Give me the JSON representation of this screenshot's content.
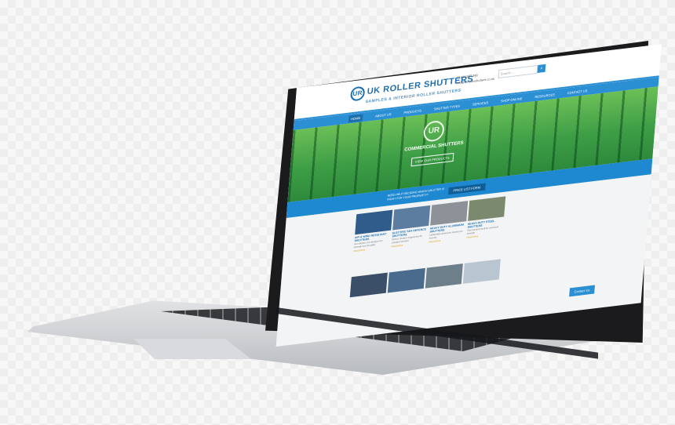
{
  "scene": {
    "description_label": "laptop-mockup",
    "colors": {
      "brand_blue": "#2b8fd4",
      "hero_green": "#3e9e46",
      "accent_gold": "#e2a51f"
    }
  },
  "website": {
    "logo": {
      "mark": "UR",
      "name": "UK ROLLER SHUTTERS",
      "tagline": "SAMPLES & INTERIOR ROLLER SHUTTERS"
    },
    "contact": {
      "phone": "01234 567 890",
      "email": "info@ukrollershutters.co.uk"
    },
    "search": {
      "placeholder": "Search ...",
      "button_icon": "search-icon"
    },
    "nav": [
      "HOME",
      "ABOUT US",
      "PRODUCTS",
      "SHUTTER TYPES",
      "SERVICES",
      "SHOP ONLINE",
      "RESOURCES",
      "CONTACT US"
    ],
    "hero": {
      "mark": "UR",
      "title": "COMMERCIAL SHUTTERS",
      "button": "VIEW OUR PRODUCTS"
    },
    "promo": {
      "text": "NEED HELP DECIDING WHICH SHUTTER IS RIGHT FOR YOUR PROPERTY?",
      "button": "PRICE LIST FORM"
    },
    "cards": [
      {
        "title": "AIR & WIND RESISTANT SHUTTERS",
        "text": "Our shutters are designed for strength and durability",
        "more": "Read More",
        "color": "#2f5c8a"
      },
      {
        "title": "ELECTRIC SEA DEFENCE SHUTTERS",
        "text": "Electric shutters engineered for coastal protection",
        "more": "Read More",
        "color": "#5d7da0"
      },
      {
        "title": "HEAVY DUTY ALUMINIUM SHUTTERS",
        "text": "Lightweight aluminium shutters for security",
        "more": "Read More",
        "color": "#8c9297"
      },
      {
        "title": "HEAVY DUTY STEEL SHUTTERS",
        "text": "Steel shutters built for maximum strength",
        "more": "Read More",
        "color": "#7b8a6e"
      },
      {
        "title": "",
        "text": "",
        "more": "",
        "color": "#3b5068"
      },
      {
        "title": "",
        "text": "",
        "more": "",
        "color": "#4a6a8e"
      },
      {
        "title": "",
        "text": "",
        "more": "",
        "color": "#6e7f8c"
      },
      {
        "title": "",
        "text": "",
        "more": "",
        "color": "#b9c6d1"
      }
    ],
    "contact_tab": "Contact Us"
  }
}
